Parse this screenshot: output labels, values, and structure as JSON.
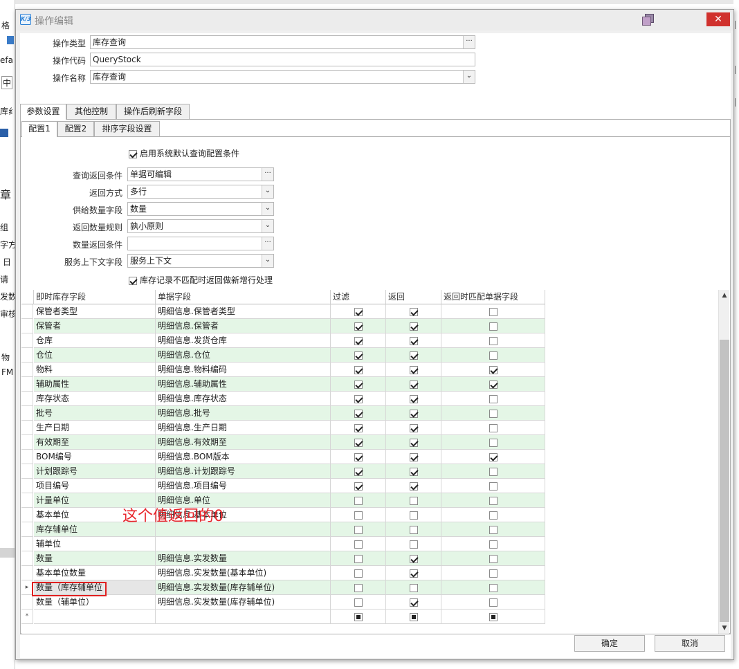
{
  "left_strip": {
    "items": [
      "格",
      "efa",
      "中",
      "库纟",
      "章",
      "组",
      "字方",
      "日",
      "请",
      "发数",
      "审核",
      "物",
      "FM"
    ]
  },
  "dialog": {
    "title": "操作编辑",
    "logo_text": "K/3",
    "close_glyph": "✕"
  },
  "header_fields": {
    "type_label": "操作类型",
    "type_value": "库存查询",
    "code_label": "操作代码",
    "code_value": "QueryStock",
    "name_label": "操作名称",
    "name_value": "库存查询"
  },
  "outer_tabs": [
    {
      "label": "参数设置",
      "active": true
    },
    {
      "label": "其他控制",
      "active": false
    },
    {
      "label": "操作后刷新字段",
      "active": false
    }
  ],
  "inner_tabs": [
    {
      "label": "配置1",
      "active": true
    },
    {
      "label": "配置2",
      "active": false
    },
    {
      "label": "排序字段设置",
      "active": false
    }
  ],
  "config": {
    "enable_default_label": "启用系统默认查询配置条件",
    "enable_default_checked": true,
    "query_return_cond_label": "查询返回条件",
    "query_return_cond_value": "单据可编辑",
    "return_mode_label": "返回方式",
    "return_mode_value": "多行",
    "supply_qty_field_label": "供给数量字段",
    "supply_qty_field_value": "数量",
    "return_qty_rule_label": "返回数量规则",
    "return_qty_rule_value": "孰小原则",
    "qty_return_cond_label": "数量返回条件",
    "qty_return_cond_value": "",
    "service_ctx_field_label": "服务上下文字段",
    "service_ctx_field_value": "服务上下文",
    "no_match_new_row_label": "库存记录不匹配时返回做新增行处理",
    "no_match_new_row_checked": true,
    "ellipsis": "···",
    "dropdown": "⌄"
  },
  "grid": {
    "headers": [
      "即时库存字段",
      "单据字段",
      "过滤",
      "返回",
      "返回时匹配单据字段"
    ],
    "rows": [
      {
        "f": "保管者类型",
        "b": "明细信息.保管者类型",
        "filter": true,
        "ret": true,
        "match": false
      },
      {
        "f": "保管者",
        "b": "明细信息.保管者",
        "filter": true,
        "ret": true,
        "match": false
      },
      {
        "f": "仓库",
        "b": "明细信息.发货仓库",
        "filter": true,
        "ret": true,
        "match": false
      },
      {
        "f": "仓位",
        "b": "明细信息.仓位",
        "filter": true,
        "ret": true,
        "match": false
      },
      {
        "f": "物料",
        "b": "明细信息.物料编码",
        "filter": true,
        "ret": true,
        "match": true
      },
      {
        "f": "辅助属性",
        "b": "明细信息.辅助属性",
        "filter": true,
        "ret": true,
        "match": true
      },
      {
        "f": "库存状态",
        "b": "明细信息.库存状态",
        "filter": true,
        "ret": true,
        "match": false
      },
      {
        "f": "批号",
        "b": "明细信息.批号",
        "filter": true,
        "ret": true,
        "match": false
      },
      {
        "f": "生产日期",
        "b": "明细信息.生产日期",
        "filter": true,
        "ret": true,
        "match": false
      },
      {
        "f": "有效期至",
        "b": "明细信息.有效期至",
        "filter": true,
        "ret": true,
        "match": false
      },
      {
        "f": "BOM编号",
        "b": "明细信息.BOM版本",
        "filter": true,
        "ret": true,
        "match": true
      },
      {
        "f": "计划跟踪号",
        "b": "明细信息.计划跟踪号",
        "filter": true,
        "ret": true,
        "match": false
      },
      {
        "f": "项目编号",
        "b": "明细信息.项目编号",
        "filter": true,
        "ret": true,
        "match": false
      },
      {
        "f": "计量单位",
        "b": "明细信息.单位",
        "filter": false,
        "ret": false,
        "match": false
      },
      {
        "f": "基本单位",
        "b": "明细信息.基本单位",
        "filter": false,
        "ret": false,
        "match": false
      },
      {
        "f": "库存辅单位",
        "b": "",
        "filter": false,
        "ret": false,
        "match": false
      },
      {
        "f": "辅单位",
        "b": "",
        "filter": false,
        "ret": false,
        "match": false
      },
      {
        "f": "数量",
        "b": "明细信息.实发数量",
        "filter": false,
        "ret": true,
        "match": false
      },
      {
        "f": "基本单位数量",
        "b": "明细信息.实发数量(基本单位)",
        "filter": false,
        "ret": true,
        "match": false
      },
      {
        "f": "数量（库存辅单位",
        "b": "明细信息.实发数量(库存辅单位)",
        "filter": false,
        "ret": false,
        "match": false,
        "current": true
      },
      {
        "f": "数量（辅单位）",
        "b": "明细信息.实发数量(库存辅单位)",
        "filter": false,
        "ret": true,
        "match": false
      }
    ],
    "new_row_marker": "*",
    "current_row_marker": "▸"
  },
  "annotation": "这个值返回的0",
  "buttons": {
    "ok": "确定",
    "cancel": "取消"
  },
  "colors": {
    "alt_row": "#e4f6e6",
    "annotation": "#e8252b",
    "close_button": "#d0312d"
  }
}
